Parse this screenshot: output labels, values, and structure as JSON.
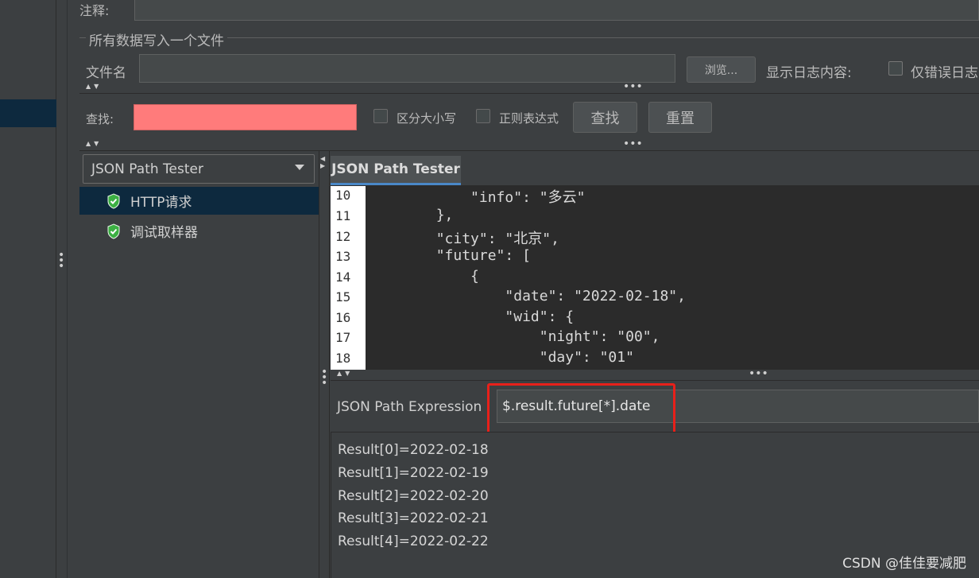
{
  "config": {
    "comment_label": "注释:",
    "group_title": "所有数据写入一个文件",
    "filename_label": "文件名",
    "browse_label": "浏览...",
    "log_label": "显示日志内容:",
    "errors_only_label": "仅错误日志"
  },
  "search": {
    "label": "查找:",
    "value": "",
    "case_sensitive_label": "区分大小写",
    "regex_label": "正则表达式",
    "find_button": "查找",
    "reset_button": "重置"
  },
  "renderer": {
    "selected": "JSON Path Tester",
    "tree": [
      {
        "label": "HTTP请求",
        "status": "success",
        "selected": true
      },
      {
        "label": "调试取样器",
        "status": "success",
        "selected": false
      }
    ]
  },
  "tester": {
    "tab_label": "JSON Path Tester",
    "code_lines": [
      {
        "num": "10",
        "text": "            \"info\": \"多云\""
      },
      {
        "num": "11",
        "text": "        },"
      },
      {
        "num": "12",
        "text": "        \"city\": \"北京\","
      },
      {
        "num": "13",
        "text": "        \"future\": ["
      },
      {
        "num": "14",
        "text": "            {"
      },
      {
        "num": "15",
        "text": "                \"date\": \"2022-02-18\","
      },
      {
        "num": "16",
        "text": "                \"wid\": {"
      },
      {
        "num": "17",
        "text": "                    \"night\": \"00\","
      },
      {
        "num": "18",
        "text": "                    \"day\": \"01\""
      }
    ],
    "expression_label": "JSON Path Expression",
    "expression_value": "$.result.future[*].date",
    "results": [
      "Result[0]=2022-02-18",
      "Result[1]=2022-02-19",
      "Result[2]=2022-02-20",
      "Result[3]=2022-02-21",
      "Result[4]=2022-02-22"
    ]
  },
  "watermark": "CSDN @佳佳要减肥",
  "colors": {
    "panel_bg": "#3c3f41",
    "editor_bg": "#2b2b2b",
    "search_bg": "#ff7b7b",
    "selection_bg": "#0d293e",
    "highlight_border": "#e8201a",
    "tab_underline": "#4a88c7",
    "success_green": "#3cb043"
  }
}
